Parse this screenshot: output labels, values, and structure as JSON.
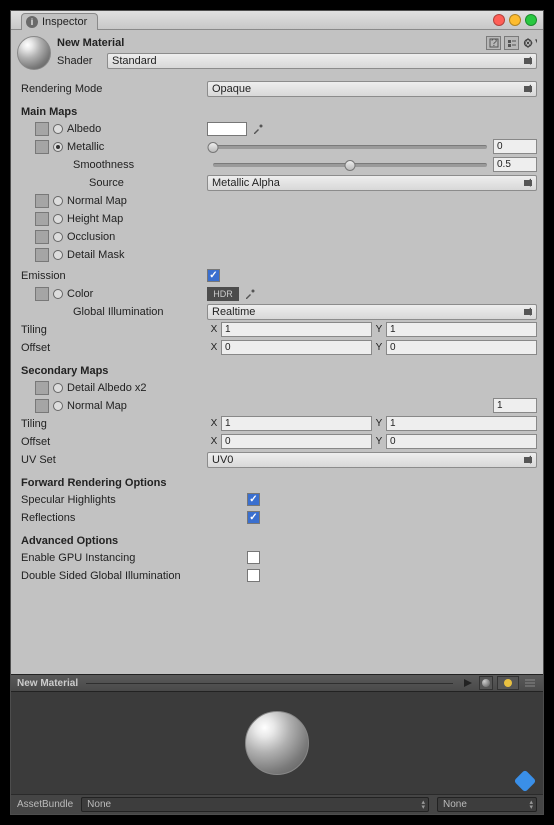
{
  "tab": {
    "label": "Inspector"
  },
  "winbtns": {
    "close": "#ff5f57",
    "min": "#febc2e",
    "max": "#28c840"
  },
  "header": {
    "name": "New Material",
    "shaderLabel": "Shader",
    "shader": "Standard"
  },
  "rendering": {
    "label": "Rendering Mode",
    "value": "Opaque"
  },
  "mainMaps": {
    "title": "Main Maps",
    "albedo": {
      "label": "Albedo"
    },
    "metallic": {
      "label": "Metallic",
      "value": "0",
      "slider": 0
    },
    "smooth": {
      "label": "Smoothness",
      "value": "0.5",
      "slider": 50
    },
    "source": {
      "label": "Source",
      "value": "Metallic Alpha"
    },
    "normal": {
      "label": "Normal Map"
    },
    "height": {
      "label": "Height Map"
    },
    "occ": {
      "label": "Occlusion"
    },
    "detail": {
      "label": "Detail Mask"
    },
    "emission": {
      "label": "Emission",
      "on": true
    },
    "color": {
      "label": "Color",
      "hdr": "HDR"
    },
    "gi": {
      "label": "Global Illumination",
      "value": "Realtime"
    },
    "tiling": {
      "label": "Tiling",
      "x": "1",
      "y": "1"
    },
    "offset": {
      "label": "Offset",
      "x": "0",
      "y": "0"
    }
  },
  "secondary": {
    "title": "Secondary Maps",
    "albedo": {
      "label": "Detail Albedo x2"
    },
    "normal": {
      "label": "Normal Map",
      "value": "1"
    },
    "tiling": {
      "label": "Tiling",
      "x": "1",
      "y": "1"
    },
    "offset": {
      "label": "Offset",
      "x": "0",
      "y": "0"
    },
    "uvset": {
      "label": "UV Set",
      "value": "UV0"
    }
  },
  "forward": {
    "title": "Forward Rendering Options",
    "spec": {
      "label": "Specular Highlights",
      "on": true
    },
    "refl": {
      "label": "Reflections",
      "on": true
    }
  },
  "advanced": {
    "title": "Advanced Options",
    "gpu": {
      "label": "Enable GPU Instancing",
      "on": false
    },
    "dsgi": {
      "label": "Double Sided Global Illumination",
      "on": false
    }
  },
  "preview": {
    "title": "New Material"
  },
  "assetbundle": {
    "label": "AssetBundle",
    "a": "None",
    "b": "None"
  }
}
